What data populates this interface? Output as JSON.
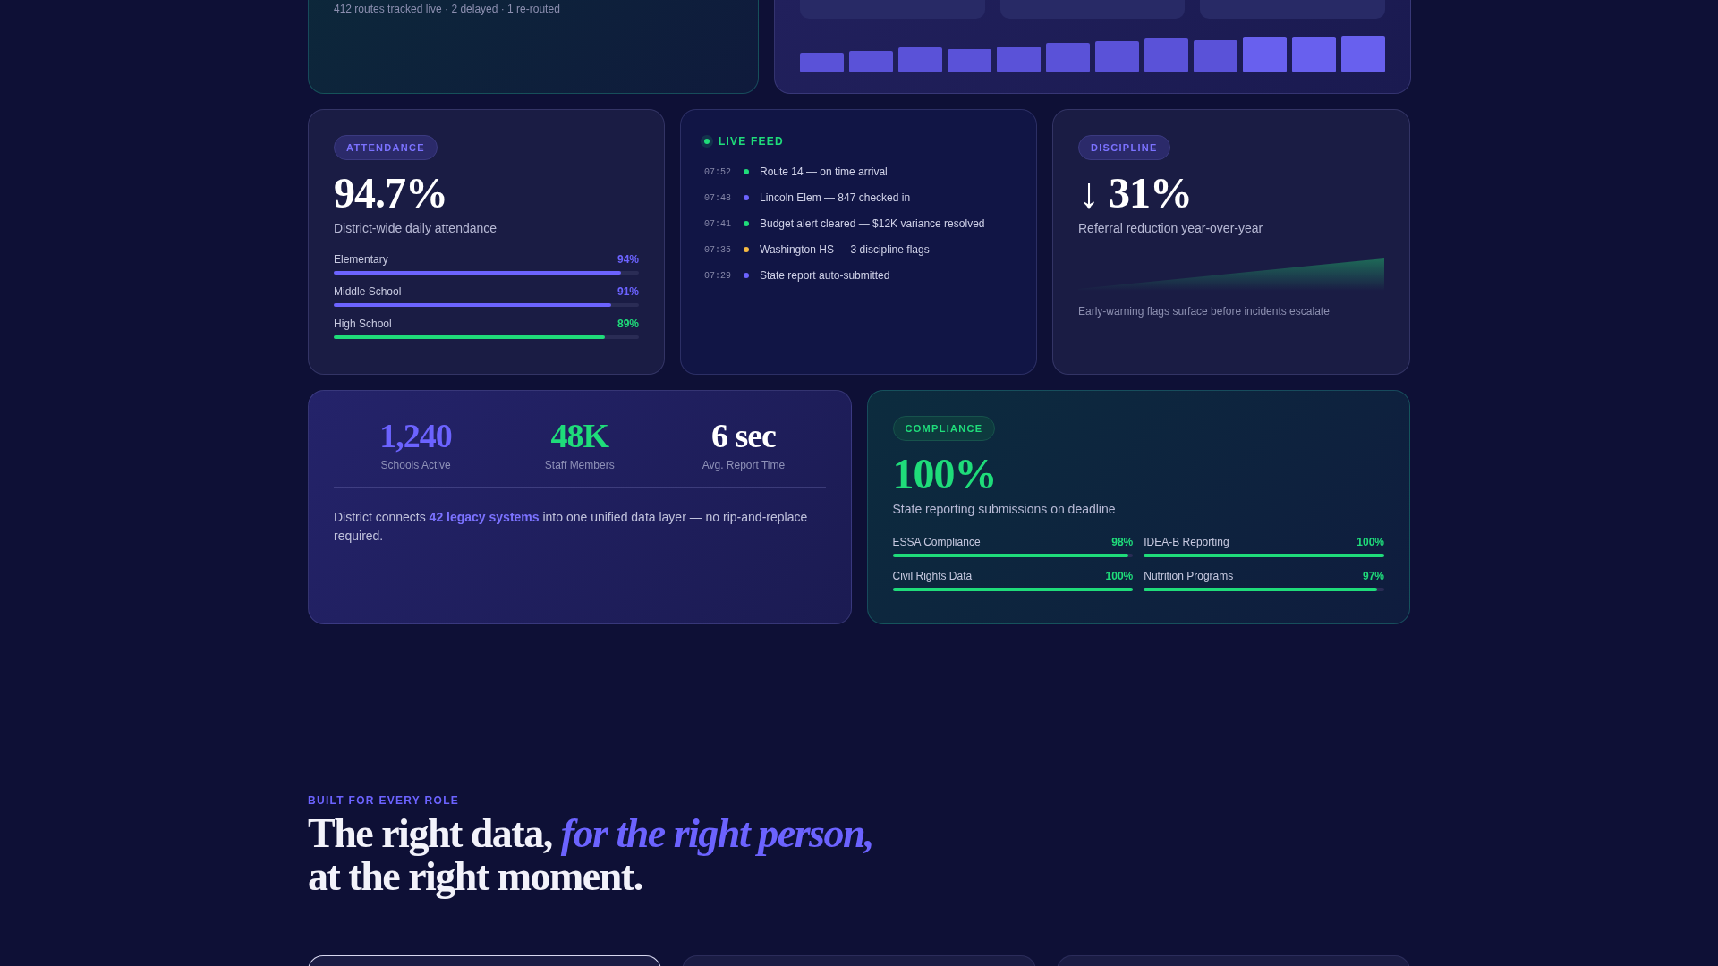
{
  "routes_card": {
    "caption": "412 routes tracked live · 2 delayed · 1 re-routed"
  },
  "attendance": {
    "tag": "ATTENDANCE",
    "value": "94.7%",
    "caption": "District-wide daily attendance",
    "bars": [
      {
        "label": "Elementary",
        "reading": "94%",
        "level": 0.94,
        "color": "#6c63ff"
      },
      {
        "label": "Middle School",
        "reading": "91%",
        "level": 0.91,
        "color": "#6c63ff"
      },
      {
        "label": "High School",
        "reading": "89%",
        "level": 0.89,
        "color": "#1fdc7a"
      }
    ]
  },
  "live_feed": {
    "title": "LIVE FEED",
    "items": [
      {
        "time": "07:52",
        "text": "Route 14 — on time arrival",
        "color": "#1fdc7a"
      },
      {
        "time": "07:48",
        "text": "Lincoln Elem — 847 checked in",
        "color": "#6c63ff"
      },
      {
        "time": "07:41",
        "text": "Budget alert cleared — $12K variance resolved",
        "color": "#1fdc7a"
      },
      {
        "time": "07:35",
        "text": "Washington HS — 3 discipline flags",
        "color": "#f5b942"
      },
      {
        "time": "07:29",
        "text": "State report auto-submitted",
        "color": "#6c63ff"
      }
    ]
  },
  "discipline": {
    "tag": "DISCIPLINE",
    "value": "↓ 31%",
    "caption": "Referral reduction year-over-year",
    "note": "Early-warning flags surface before incidents escalate"
  },
  "stats_card": {
    "stats": [
      {
        "value": "1,240",
        "label": "Schools Active",
        "color": "#6c63ff"
      },
      {
        "value": "48K",
        "label": "Staff Members",
        "color": "#1fdc7a"
      },
      {
        "value": "6 sec",
        "label": "Avg. Report Time",
        "color": "#ffffff"
      }
    ],
    "description": "District connects **42 legacy systems** into one unified data layer — no rip-and-replace required."
  },
  "compliance": {
    "tag": "COMPLIANCE",
    "value": "100%",
    "caption": "State reporting submissions on deadline",
    "bars": [
      {
        "label": "ESSA Compliance",
        "reading": "98%",
        "level": 0.98
      },
      {
        "label": "IDEA-B Reporting",
        "reading": "100%",
        "level": 1
      },
      {
        "label": "Civil Rights Data",
        "reading": "100%",
        "level": 1
      },
      {
        "label": "Nutrition Programs",
        "reading": "97%",
        "level": 0.97
      }
    ]
  },
  "roles_section": {
    "eyebrow": "BUILT FOR EVERY ROLE",
    "headline": "The right data, *for the right person,* at the right moment.",
    "cards": [
      {
        "selected": true
      },
      {
        "selected": false
      },
      {
        "selected": false
      }
    ]
  }
}
